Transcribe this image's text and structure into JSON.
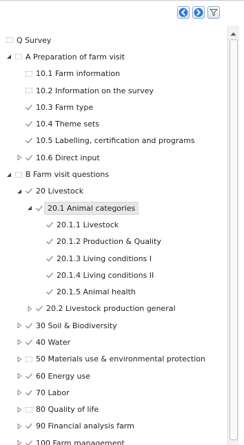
{
  "toolbar": {
    "back_icon": "arrow-left-circle-icon",
    "forward_icon": "arrow-right-circle-icon",
    "filter_icon": "funnel-icon",
    "accent": "#2e7bd6"
  },
  "tree": {
    "items": [
      {
        "level": 0,
        "expander": "none",
        "status": "empty",
        "label": "Q Survey",
        "name": "q-survey"
      },
      {
        "level": 0,
        "expander": "expanded",
        "status": "empty",
        "label": "A Preparation of farm visit",
        "name": "a-preparation"
      },
      {
        "level": 1,
        "expander": "none",
        "status": "empty",
        "label": "10.1 Farm information",
        "name": "10-1"
      },
      {
        "level": 1,
        "expander": "none",
        "status": "empty",
        "label": "10.2 Information on the survey",
        "name": "10-2"
      },
      {
        "level": 1,
        "expander": "none",
        "status": "check",
        "label": "10.3 Farm type",
        "name": "10-3"
      },
      {
        "level": 1,
        "expander": "none",
        "status": "check",
        "label": "10.4 Theme sets",
        "name": "10-4"
      },
      {
        "level": 1,
        "expander": "none",
        "status": "check",
        "label": "10.5 Labelling, certification and programs",
        "name": "10-5"
      },
      {
        "level": 1,
        "expander": "collapsed",
        "status": "check",
        "label": "10.6 Direct input",
        "name": "10-6"
      },
      {
        "level": 0,
        "expander": "expanded",
        "status": "empty",
        "label": "B Farm visit questions",
        "name": "b-farm-visit"
      },
      {
        "level": 1,
        "expander": "expanded",
        "status": "check",
        "label": "20 Livestock",
        "name": "20"
      },
      {
        "level": 2,
        "expander": "expanded",
        "status": "check",
        "label": "20.1 Animal categories",
        "name": "20-1",
        "selected": true
      },
      {
        "level": 3,
        "expander": "none",
        "status": "check",
        "label": "20.1.1 Livestock",
        "name": "20-1-1"
      },
      {
        "level": 3,
        "expander": "none",
        "status": "check",
        "label": "20.1.2 Production & Quality",
        "name": "20-1-2"
      },
      {
        "level": 3,
        "expander": "none",
        "status": "check",
        "label": "20.1.3 Living conditions I",
        "name": "20-1-3"
      },
      {
        "level": 3,
        "expander": "none",
        "status": "check",
        "label": "20.1.4 Living conditions II",
        "name": "20-1-4"
      },
      {
        "level": 3,
        "expander": "none",
        "status": "check",
        "label": "20.1.5 Animal health",
        "name": "20-1-5"
      },
      {
        "level": 2,
        "expander": "collapsed",
        "status": "check",
        "label": "20.2 Livestock production general",
        "name": "20-2"
      },
      {
        "level": 1,
        "expander": "collapsed",
        "status": "check",
        "label": "30 Soil & Biodiversity",
        "name": "30"
      },
      {
        "level": 1,
        "expander": "collapsed",
        "status": "check",
        "label": "40 Water",
        "name": "40"
      },
      {
        "level": 1,
        "expander": "collapsed",
        "status": "empty",
        "label": "50 Materials use & environmental protection",
        "name": "50"
      },
      {
        "level": 1,
        "expander": "collapsed",
        "status": "check",
        "label": "60 Energy use",
        "name": "60"
      },
      {
        "level": 1,
        "expander": "collapsed",
        "status": "check",
        "label": "70 Labor",
        "name": "70"
      },
      {
        "level": 1,
        "expander": "collapsed",
        "status": "empty",
        "label": "80 Quality of life",
        "name": "80"
      },
      {
        "level": 1,
        "expander": "collapsed",
        "status": "check",
        "label": "90 Financial analysis farm",
        "name": "90"
      },
      {
        "level": 1,
        "expander": "collapsed",
        "status": "check",
        "label": "100 Farm management",
        "name": "100"
      }
    ]
  }
}
